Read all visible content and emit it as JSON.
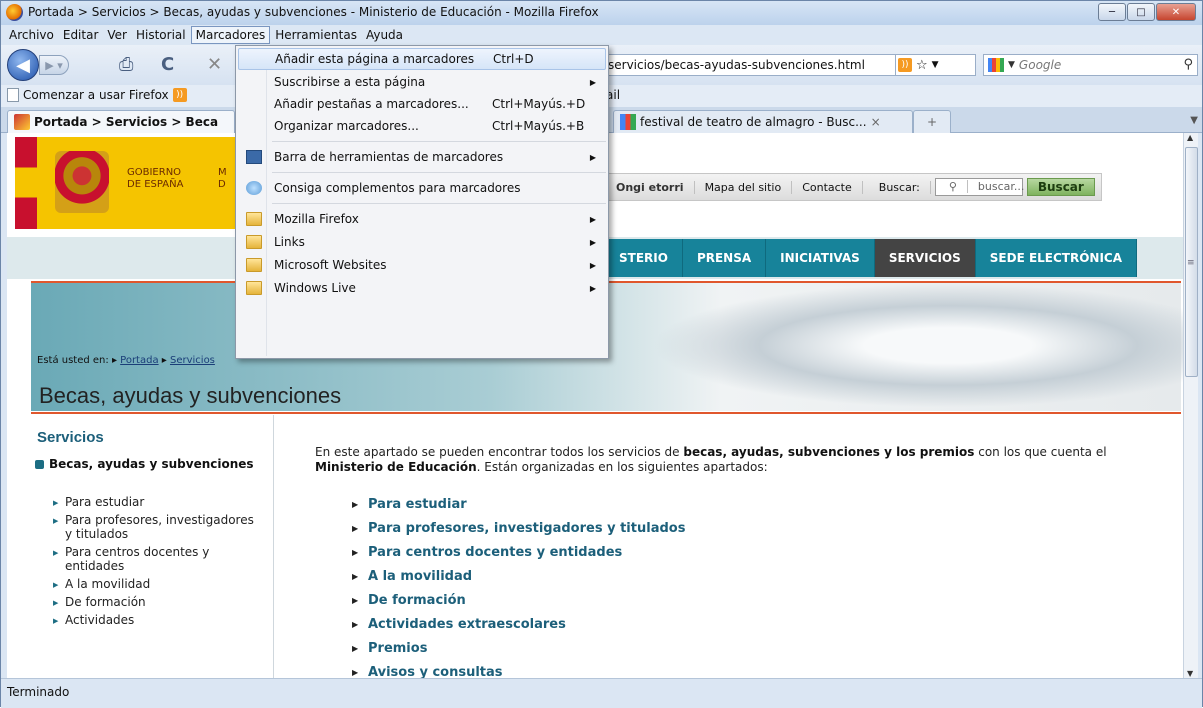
{
  "window": {
    "title": "Portada > Servicios > Becas, ayudas y subvenciones - Ministerio de Educación - Mozilla Firefox"
  },
  "menubar": [
    "Archivo",
    "Editar",
    "Ver",
    "Historial",
    "Marcadores",
    "Herramientas",
    "Ayuda"
  ],
  "navbar": {
    "url_fragment": "servicios/becas-ayudas-subvenciones.html",
    "search_placeholder": "Google"
  },
  "bookmarks_bar": {
    "first": "Comenzar a usar Firefox",
    "fragment": "ail"
  },
  "tabs": [
    {
      "label": "Portada > Servicios > Beca"
    },
    {
      "label": "festival de teatro de almagro - Busc...",
      "close": "×"
    },
    {
      "label": "+"
    }
  ],
  "dropdown": {
    "items": [
      {
        "label": "Añadir esta página a marcadores",
        "shortcut": "Ctrl+D"
      },
      {
        "label": "Suscribirse a esta página",
        "arrow": "▶"
      },
      {
        "label": "Añadir pestañas a marcadores...",
        "shortcut": "Ctrl+Mayús.+D"
      },
      {
        "label": "Organizar marcadores...",
        "shortcut": "Ctrl+Mayús.+B"
      },
      {
        "label": "Barra de herramientas de marcadores",
        "arrow": "▶"
      },
      {
        "label": "Consiga complementos para marcadores"
      },
      {
        "label": "Mozilla Firefox",
        "arrow": "▶"
      },
      {
        "label": "Links",
        "arrow": "▶"
      },
      {
        "label": "Microsoft Websites",
        "arrow": "▶"
      },
      {
        "label": "Windows Live",
        "arrow": "▶"
      }
    ]
  },
  "site": {
    "logo_gov": "GOBIERNO\nDE ESPAÑA",
    "logo_min_frag": "M\nD",
    "toplinks": [
      "Ongi etorri",
      "Mapa del sitio",
      "Contacte"
    ],
    "search_label": "Buscar:",
    "search_placeholder": "buscar...",
    "search_button": "Buscar",
    "nav": [
      "STERIO",
      "PRENSA",
      "INICIATIVAS",
      "SERVICIOS",
      "SEDE ELECTRÓNICA"
    ],
    "breadcrumb_prefix": "Está usted en:",
    "breadcrumb": [
      "Portada",
      "Servicios"
    ],
    "page_title": "Becas, ayudas y subvenciones",
    "sidebar_title": "Servicios",
    "sidebar_section": "Becas, ayudas y subvenciones",
    "sidebar_items": [
      "Para estudiar",
      "Para profesores, investigadores y titulados",
      "Para centros docentes y entidades",
      "A la movilidad",
      "De formación",
      "Actividades"
    ],
    "intro_parts": [
      "En este apartado se pueden encontrar todos los servicios de ",
      "becas, ayudas, subvenciones y los premios",
      " con los que cuenta el ",
      "Ministerio de Educación",
      ". Están organizadas en los siguientes apartados:"
    ],
    "links": [
      "Para estudiar",
      "Para profesores, investigadores y titulados",
      "Para centros docentes y entidades",
      "A la movilidad",
      "De formación",
      "Actividades extraescolares",
      "Premios",
      "Avisos y consultas"
    ]
  },
  "status": "Terminado"
}
